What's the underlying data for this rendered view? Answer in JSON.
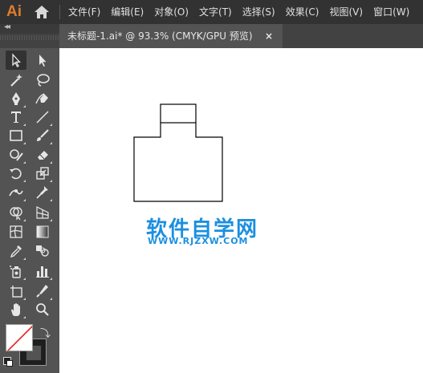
{
  "app": {
    "logo": "Ai",
    "icons": {
      "home": "home-icon"
    }
  },
  "menu": [
    {
      "label": "文件(F)"
    },
    {
      "label": "编辑(E)"
    },
    {
      "label": "对象(O)"
    },
    {
      "label": "文字(T)"
    },
    {
      "label": "选择(S)"
    },
    {
      "label": "效果(C)"
    },
    {
      "label": "视图(V)"
    },
    {
      "label": "窗口(W)"
    }
  ],
  "panel": {
    "collapse": "◂◂"
  },
  "document": {
    "tab_title": "未标题-1.ai* @ 93.3% (CMYK/GPU 预览)",
    "close": "×"
  },
  "tools": [
    {
      "icon": "selection-tool-icon"
    },
    {
      "icon": "direct-selection-tool-icon"
    },
    {
      "icon": "magic-wand-tool-icon"
    },
    {
      "icon": "lasso-tool-icon"
    },
    {
      "icon": "pen-tool-icon"
    },
    {
      "icon": "curvature-tool-icon"
    },
    {
      "icon": "type-tool-icon"
    },
    {
      "icon": "line-segment-tool-icon"
    },
    {
      "icon": "rectangle-tool-icon"
    },
    {
      "icon": "paintbrush-tool-icon"
    },
    {
      "icon": "shaper-tool-icon"
    },
    {
      "icon": "eraser-tool-icon"
    },
    {
      "icon": "rotate-tool-icon"
    },
    {
      "icon": "scale-tool-icon"
    },
    {
      "icon": "width-tool-icon"
    },
    {
      "icon": "puppet-warp-tool-icon"
    },
    {
      "icon": "shape-builder-tool-icon"
    },
    {
      "icon": "perspective-grid-tool-icon"
    },
    {
      "icon": "mesh-tool-icon"
    },
    {
      "icon": "gradient-tool-icon"
    },
    {
      "icon": "eyedropper-tool-icon"
    },
    {
      "icon": "blend-tool-icon"
    },
    {
      "icon": "symbol-sprayer-tool-icon"
    },
    {
      "icon": "column-graph-tool-icon"
    },
    {
      "icon": "artboard-tool-icon"
    },
    {
      "icon": "slice-tool-icon"
    },
    {
      "icon": "hand-tool-icon"
    },
    {
      "icon": "zoom-tool-icon"
    }
  ],
  "colors": {
    "fill": "none",
    "stroke": "#1e1e1e",
    "accent": "#e07c2a",
    "watermark": "#1b8fe0"
  },
  "watermark": {
    "title": "软件自学网",
    "url": "WWW.RJZXW.COM"
  }
}
